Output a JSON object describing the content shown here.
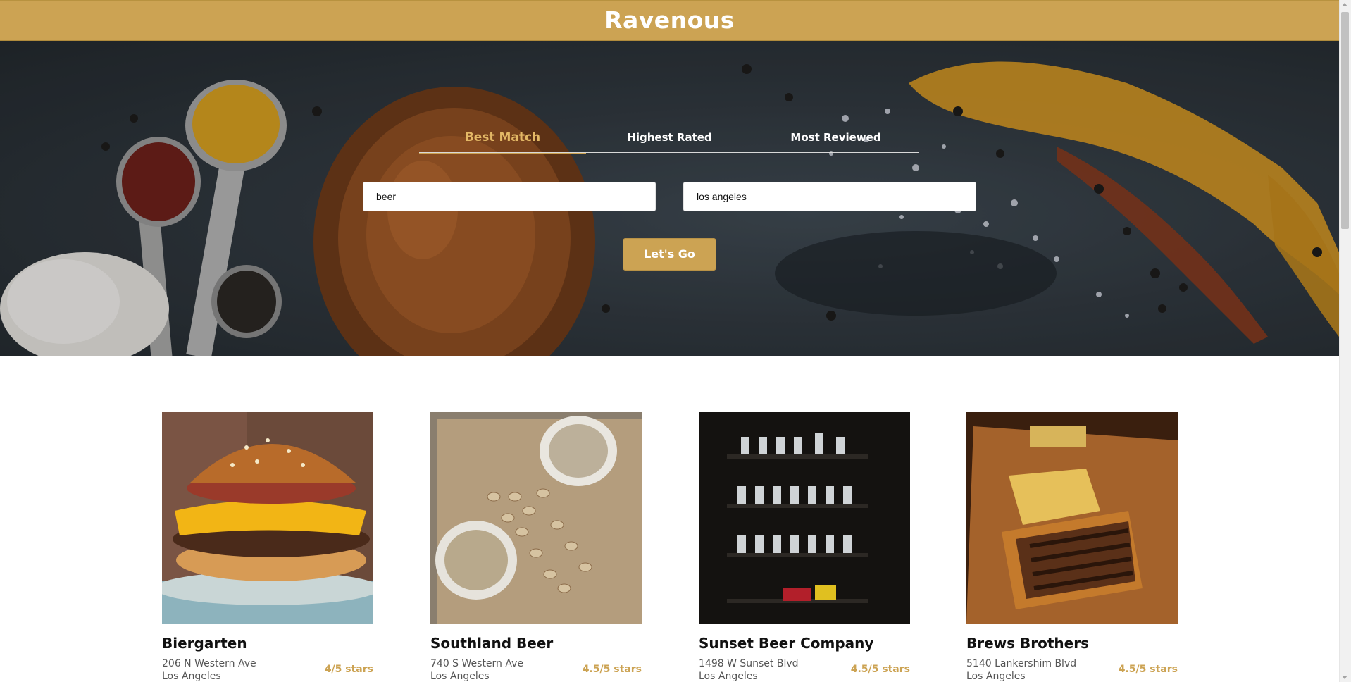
{
  "header": {
    "title": "Ravenous",
    "bg_color": "#cca353"
  },
  "hero": {
    "image": "spices-and-wooden-spoon-background",
    "sort_tabs": [
      {
        "label": "Best Match",
        "active": true
      },
      {
        "label": "Highest Rated",
        "active": false
      },
      {
        "label": "Most Reviewed",
        "active": false
      }
    ],
    "search_term": "beer",
    "location": "los angeles",
    "submit_label": "Let's Go"
  },
  "accent_color": "#cca353",
  "businesses": [
    {
      "name": "Biergarten",
      "address": "206 N Western Ave",
      "city": "Los Angeles",
      "rating_text": "4/5 stars",
      "rating": 4,
      "image": "cheeseburger-photo"
    },
    {
      "name": "Southland Beer",
      "address": "740 S Western Ave",
      "city": "Los Angeles",
      "rating_text": "4.5/5 stars",
      "rating": 4.5,
      "image": "pistachio-shells-photo"
    },
    {
      "name": "Sunset Beer Company",
      "address": "1498 W Sunset Blvd",
      "city": "Los Angeles",
      "rating_text": "4.5/5 stars",
      "rating": 4.5,
      "image": "beer-shelves-photo"
    },
    {
      "name": "Brews Brothers",
      "address": "5140 Lankershim Blvd",
      "city": "Los Angeles",
      "rating_text": "4.5/5 stars",
      "rating": 4.5,
      "image": "grilled-sandwich-photo"
    }
  ]
}
